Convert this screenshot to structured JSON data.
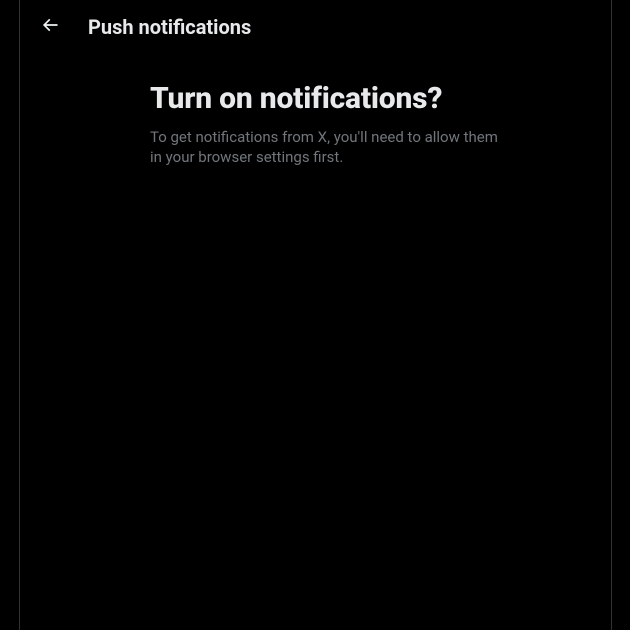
{
  "header": {
    "title": "Push notifications"
  },
  "content": {
    "headline": "Turn on notifications?",
    "description": "To get notifications from X, you'll need to allow them in your browser settings first."
  }
}
